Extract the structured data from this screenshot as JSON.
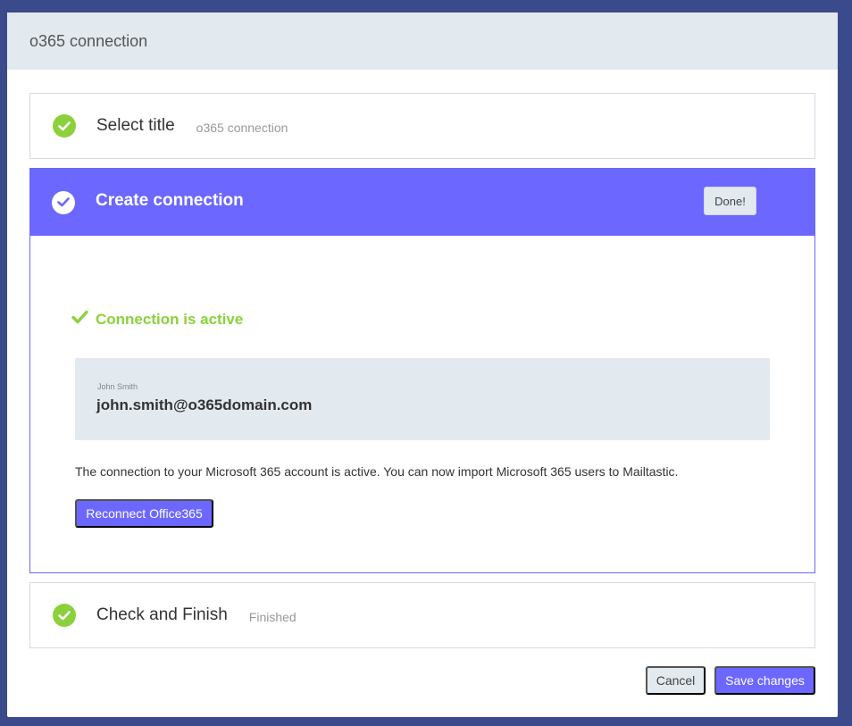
{
  "modal": {
    "title": "o365 connection"
  },
  "steps": [
    {
      "title": "Select title",
      "subtitle": "o365 connection",
      "icon": "check-circle-icon"
    },
    {
      "title": "Create connection",
      "done_label": "Done!",
      "icon": "check-circle-icon"
    },
    {
      "title": "Check and Finish",
      "subtitle": "Finished",
      "icon": "check-circle-icon"
    }
  ],
  "connection": {
    "status": "Connection is active",
    "account_name": "John Smith",
    "account_email": "john.smith@o365domain.com",
    "info": "The connection to your Microsoft 365 account is active. You can now import Microsoft 365 users to Mailtastic.",
    "reconnect_label": "Reconnect Office365"
  },
  "footer": {
    "cancel_label": "Cancel",
    "save_label": "Save changes"
  },
  "colors": {
    "accent": "#6b67ff",
    "success": "#8bd13c",
    "header_bg": "#e2e9ef",
    "backdrop": "#3a4a8a"
  }
}
